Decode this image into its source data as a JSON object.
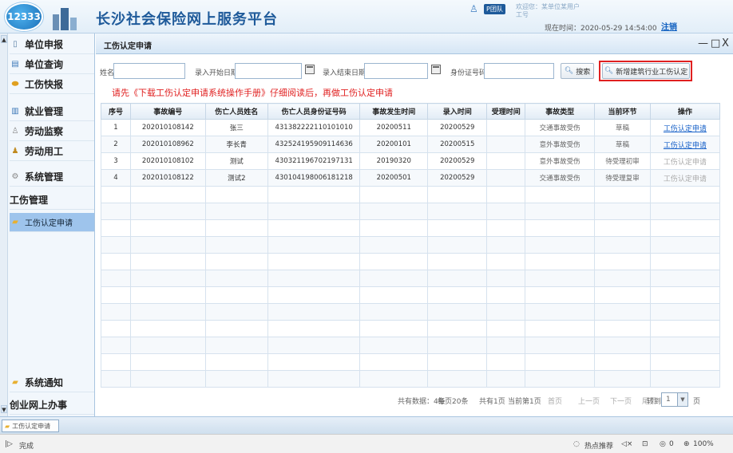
{
  "header": {
    "logo_text": "12333",
    "title": "长沙社会保险网上服务平台",
    "user_badge": "P团队",
    "welcome_line1": "欢迎您：某单位某用户",
    "welcome_line2": "工号",
    "now_time": "现在时间：2020-05-29 14:54:00",
    "logout": "注销"
  },
  "sidebar": {
    "items": [
      {
        "label": "单位申报",
        "icon": "doc-icon"
      },
      {
        "label": "单位查询",
        "icon": "list-icon"
      },
      {
        "label": "工伤快报",
        "icon": "warning-icon"
      },
      {
        "label": "就业管理",
        "icon": "table-icon"
      },
      {
        "label": "劳动监察",
        "icon": "person-icon"
      },
      {
        "label": "劳动用工",
        "icon": "worker-icon"
      },
      {
        "label": "系统管理",
        "icon": "gear-icon"
      }
    ],
    "section": "工伤管理",
    "sub_item": "工伤认定申请",
    "bottom_items": [
      "系统通知",
      "创业网上办事"
    ]
  },
  "panel": {
    "title": "工伤认定申请",
    "controls": [
      "—",
      "□",
      "X"
    ]
  },
  "search": {
    "name_label": "姓名",
    "start_label": "录入开始日期",
    "end_label": "录入结束日期",
    "id_label": "身份证号码",
    "search_button": "搜索",
    "new_button": "新增建筑行业工伤认定"
  },
  "notice": "请先《下载工伤认定申请系统操作手册》仔细阅读后，再做工伤认定申请",
  "table": {
    "headers": [
      "序号",
      "事故编号",
      "伤亡人员姓名",
      "伤亡人员身份证号码",
      "事故发生时间",
      "录入时间",
      "受理时间",
      "事故类型",
      "当前环节",
      "操作"
    ],
    "rows": [
      [
        "1",
        "202010108142",
        "张三",
        "431382222110101010",
        "20200511",
        "20200529",
        "",
        "交通事故受伤",
        "草稿",
        "工伤认定申请"
      ],
      [
        "2",
        "202010108962",
        "李长青",
        "432524195909114636",
        "20200101",
        "20200515",
        "",
        "意外事故受伤",
        "草稿",
        "工伤认定申请"
      ],
      [
        "3",
        "202010108102",
        "测试",
        "430321196702197131",
        "20190320",
        "20200529",
        "",
        "意外事故受伤",
        "待受理初审",
        "工伤认定申请"
      ],
      [
        "4",
        "202010108122",
        "测试2",
        "430104198006181218",
        "20200501",
        "20200529",
        "",
        "交通事故受伤",
        "待受理复审",
        "工伤认定申请"
      ]
    ]
  },
  "pager": {
    "total": "共有数据：4条",
    "per_page": "每页20条",
    "pages": "共有1页",
    "current": "当前第1页",
    "first": "首页",
    "prev": "上一页",
    "next": "下一页",
    "last": "尾页",
    "goto": "转到",
    "page_value": "1",
    "page_unit": "页"
  },
  "taskbar": {
    "tab": "工伤认定申请"
  },
  "statusbar": {
    "status": "完成",
    "hot": "热点推荐",
    "count": "0",
    "zoom": "100%"
  }
}
